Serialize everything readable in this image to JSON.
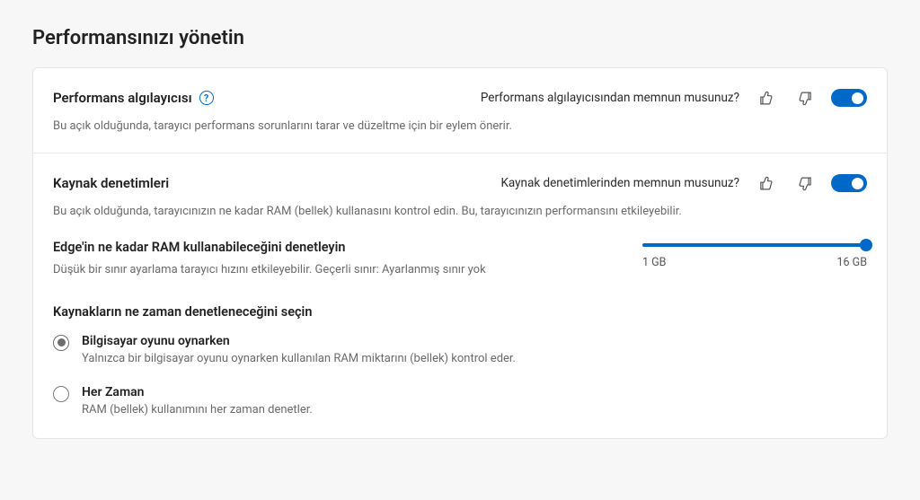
{
  "page": {
    "title": "Performansınızı yönetin"
  },
  "detector": {
    "title": "Performans algılayıcısı",
    "desc": "Bu açık olduğunda, tarayıcı performans sorunlarını tarar ve düzeltme için bir eylem önerir.",
    "feedback_question": "Performans algılayıcısından memnun musunuz?",
    "toggle_on": true
  },
  "resources": {
    "title": "Kaynak denetimleri",
    "desc": "Bu açık olduğunda, tarayıcınızın ne kadar RAM (bellek) kullanasını kontrol edin. Bu, tarayıcınızın performansını etkileyebilir.",
    "feedback_question": "Kaynak denetimlerinden memnun musunuz?",
    "toggle_on": true
  },
  "ram": {
    "title": "Edge'in ne kadar RAM kullanabileceğini denetleyin",
    "desc": "Düşük bir sınır ayarlama tarayıcı hızını etkileyebilir. Geçerli sınır: Ayarlanmış sınır yok",
    "min_label": "1 GB",
    "max_label": "16 GB"
  },
  "when": {
    "title": "Kaynakların ne zaman denetleneceğini seçin",
    "options": [
      {
        "label": "Bilgisayar oyunu oynarken",
        "desc": "Yalnızca bir bilgisayar oyunu oynarken kullanılan RAM miktarını (bellek) kontrol eder.",
        "selected": true
      },
      {
        "label": "Her Zaman",
        "desc": "RAM (bellek) kullanımını her zaman denetler.",
        "selected": false
      }
    ]
  }
}
